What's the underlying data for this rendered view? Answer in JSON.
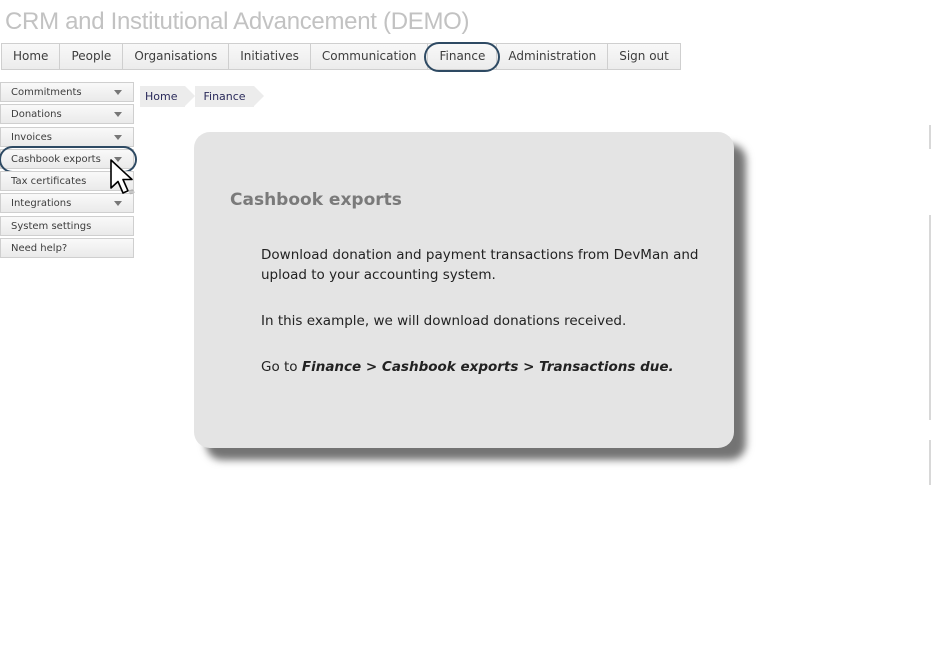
{
  "app": {
    "title": "CRM and Institutional Advancement (DEMO)"
  },
  "top_nav": {
    "items": [
      {
        "label": "Home"
      },
      {
        "label": "People"
      },
      {
        "label": "Organisations"
      },
      {
        "label": "Initiatives"
      },
      {
        "label": "Communication"
      },
      {
        "label": "Finance"
      },
      {
        "label": "Administration"
      },
      {
        "label": "Sign out"
      }
    ],
    "highlighted": "Finance"
  },
  "sidebar": {
    "items": [
      {
        "label": "Commitments",
        "has_dropdown": true
      },
      {
        "label": "Donations",
        "has_dropdown": true
      },
      {
        "label": "Invoices",
        "has_dropdown": true
      },
      {
        "label": "Cashbook exports",
        "has_dropdown": true
      },
      {
        "label": "Tax certificates",
        "has_dropdown": false
      },
      {
        "label": "Integrations",
        "has_dropdown": true
      },
      {
        "label": "System settings",
        "has_dropdown": false
      },
      {
        "label": "Need help?",
        "has_dropdown": false
      }
    ],
    "highlighted": "Cashbook exports"
  },
  "breadcrumb": {
    "items": [
      {
        "label": "Home"
      },
      {
        "label": "Finance"
      }
    ]
  },
  "info_card": {
    "title": "Cashbook exports",
    "para1": "Download donation and payment transactions from DevMan and upload to your accounting system.",
    "para2": "In this example, we will download donations received.",
    "para3_prefix": "Go to ",
    "para3_path": "Finance > Cashbook exports > Transactions due."
  },
  "colors": {
    "highlight_ring": "#2e4a63",
    "card_background": "#e4e4e4",
    "title_text": "#c2c2c2"
  },
  "icons": {
    "cursor": "mouse-pointer-icon",
    "caret": "chevron-down-icon"
  }
}
